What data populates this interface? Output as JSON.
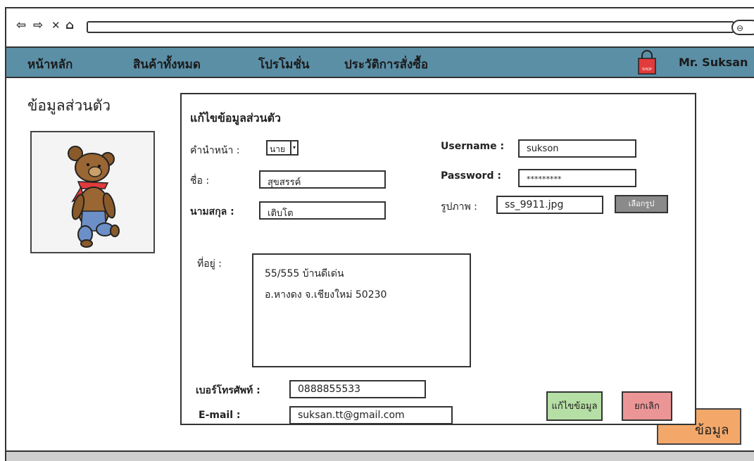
{
  "browser": {
    "back": "⇦",
    "forward": "⇨",
    "close": "✕",
    "home": "⌂"
  },
  "topnav": {
    "items": [
      "หน้าหลัก",
      "สินค้าทั้งหมด",
      "โปรโมชั่น",
      "ประวัติการสั่งซื้อ"
    ],
    "shop_label": "SHOP",
    "user": "Mr. Suksan"
  },
  "profile": {
    "heading": "ข้อมูลส่วนตัว"
  },
  "background_button": {
    "label": "ข้อมูล"
  },
  "dialog": {
    "title": "แก้ไขข้อมูลส่วนตัว",
    "prefix_label": "คำนำหน้า :",
    "prefix_value": "นาย",
    "firstname_label": "ชื่อ :",
    "firstname_value": "สุขสรรค์",
    "lastname_label": "นามสกุล :",
    "lastname_value": "เติบโต",
    "username_label": "Username  :",
    "username_value": "sukson",
    "password_label": "Password  :",
    "password_value": "*********",
    "photo_label": "รูปภาพ :",
    "photo_value": "ss_9911.jpg",
    "choose_button": "เลือกรูป",
    "address_label": "ที่อยู่  :",
    "address_lines": [
      "55/555 บ้านดีเด่น",
      "อ.หางดง จ.เชียงใหม่ 50230"
    ],
    "phone_label": "เบอร์โทรศัพท์  :",
    "phone_value": "0888855533",
    "email_label": "E-mail  :",
    "email_value": "suksan.tt@gmail.com",
    "save_button": "แก้ไขข้อมูล",
    "cancel_button": "ยกเลิก"
  },
  "colors": {
    "nav_bg": "#5b8fa6",
    "save_bg": "#b5dfa4",
    "cancel_bg": "#ec9597",
    "orange_btn": "#f3a86a",
    "shop_red": "#e23b3b"
  }
}
